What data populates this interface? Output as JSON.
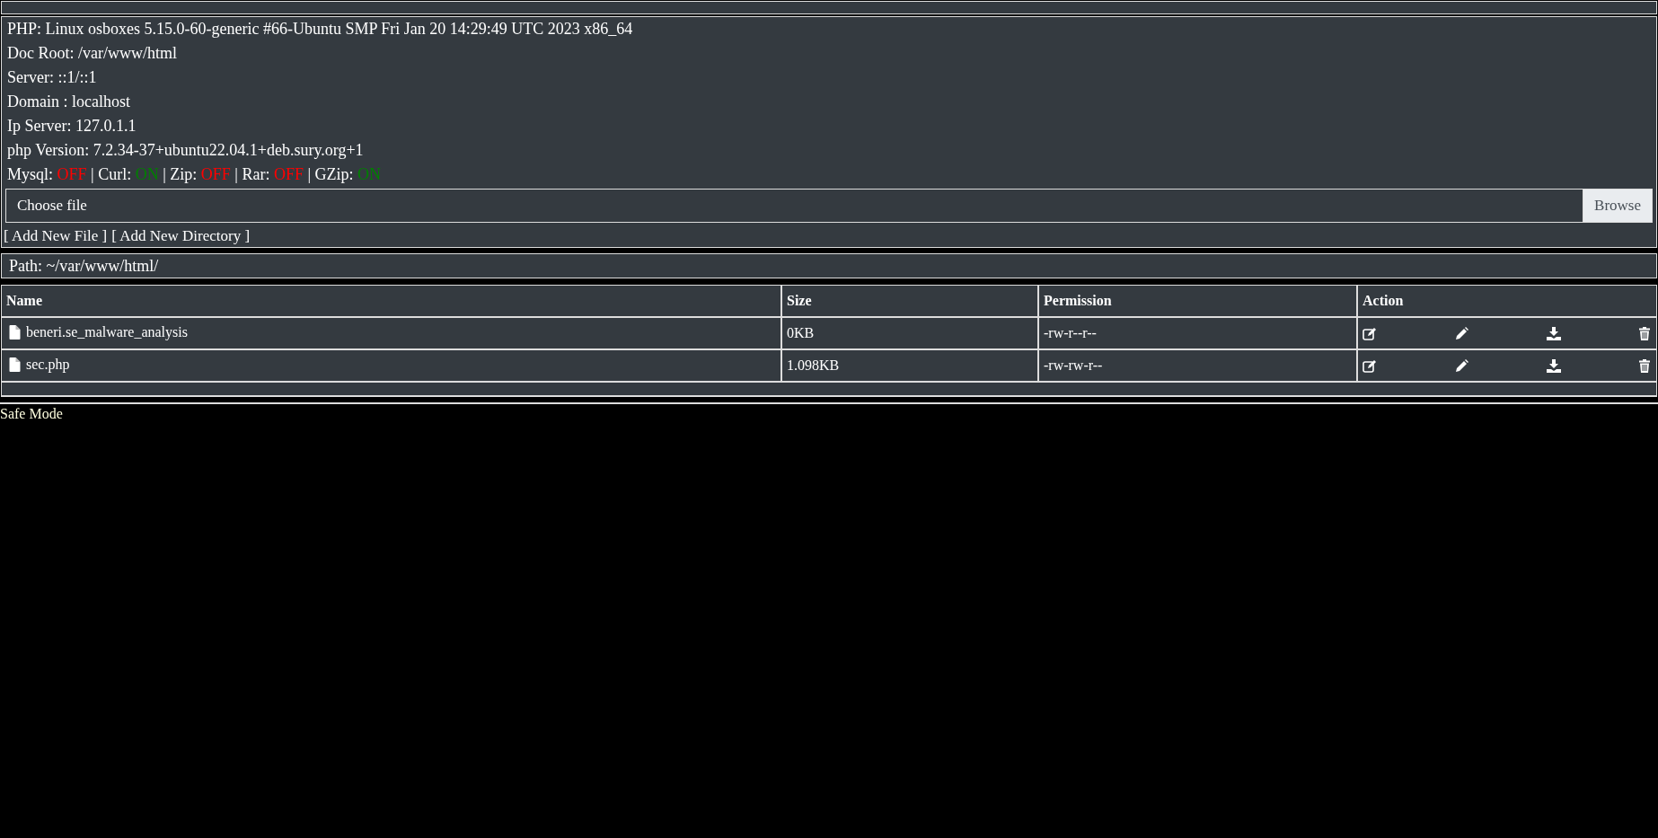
{
  "system_info": [
    "PHP: Linux osboxes 5.15.0-60-generic #66-Ubuntu SMP Fri Jan 20 14:29:49 UTC 2023 x86_64",
    "Doc Root: /var/www/html",
    "Server: ::1/::1",
    "Domain : localhost",
    "Ip Server: 127.0.1.1",
    "php Version: 7.2.34-37+ubuntu22.04.1+deb.sury.org+1"
  ],
  "extensions": [
    {
      "label": "Mysql:",
      "value": "OFF",
      "on": false
    },
    {
      "separator": "|",
      "label": "Curl:",
      "value": "ON",
      "on": true
    },
    {
      "separator": "|",
      "label": "Zip:",
      "value": "OFF",
      "on": false
    },
    {
      "separator": "|",
      "label": "Rar:",
      "value": "OFF",
      "on": false
    },
    {
      "separator": "|",
      "label": "GZip:",
      "value": "ON",
      "on": true
    }
  ],
  "upload": {
    "placeholder": "Choose file",
    "button": "Browse"
  },
  "links": [
    "[ Add New File ]",
    "[ Add New Directory ]"
  ],
  "path": "Path: ~/var/www/html/",
  "table": {
    "columns": [
      "Name",
      "Size",
      "Permission",
      "Action"
    ],
    "rows": [
      {
        "name": "beneri.se_malware_analysis",
        "size": "0KB",
        "permission": "-rw-r--r--"
      },
      {
        "name": "sec.php",
        "size": "1.098KB",
        "permission": "-rw-rw-r--"
      }
    ]
  },
  "footer": "Safe Mode"
}
